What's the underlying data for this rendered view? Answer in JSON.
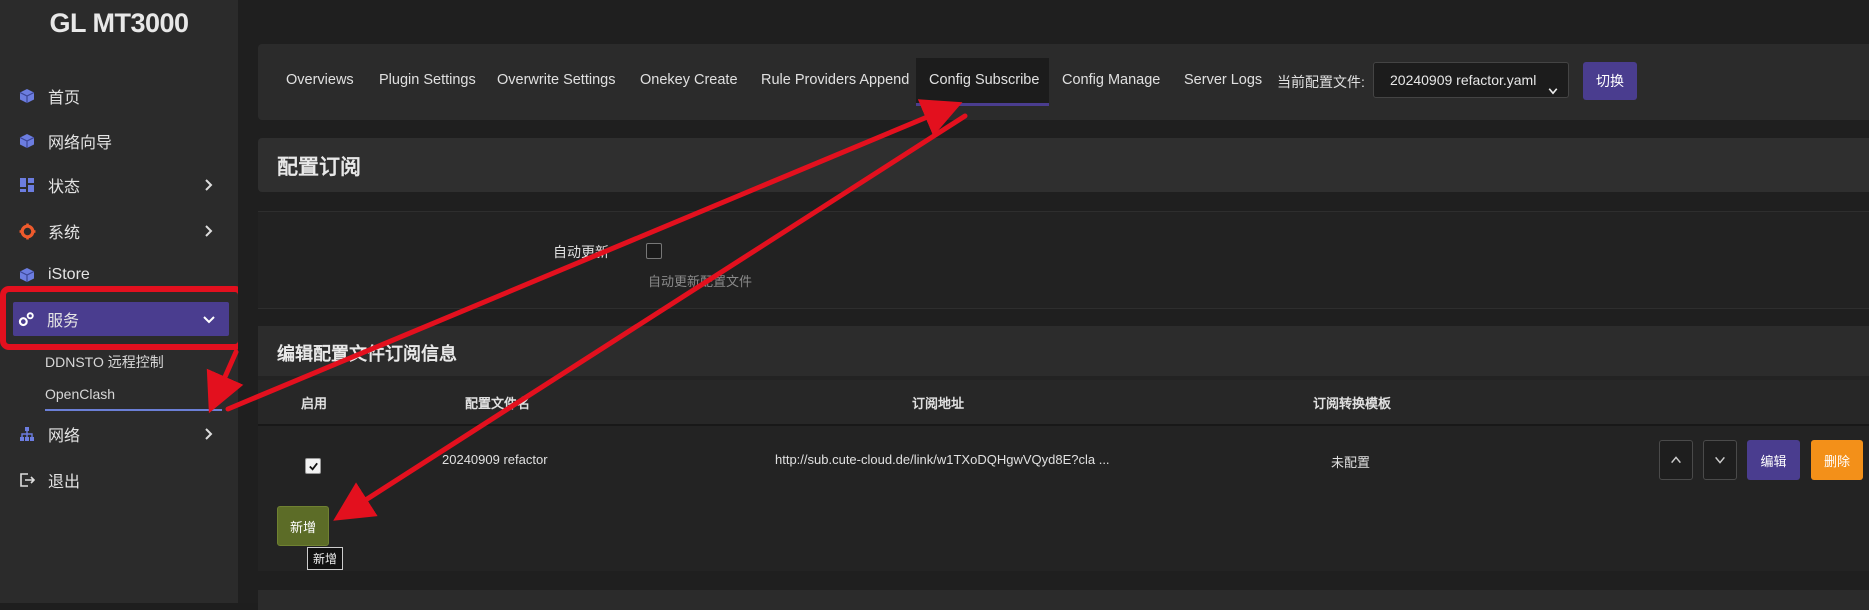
{
  "brand": "GL MT3000",
  "sidebar": {
    "items": [
      {
        "label": "首页",
        "icon": "cube-icon"
      },
      {
        "label": "网络向导",
        "icon": "cube-icon"
      },
      {
        "label": "状态",
        "icon": "dashboard-icon"
      },
      {
        "label": "系统",
        "icon": "gear-icon"
      },
      {
        "label": "iStore",
        "icon": "cube-icon"
      },
      {
        "label": "服务",
        "icon": "gears-icon"
      },
      {
        "label": "网络",
        "icon": "network-icon"
      },
      {
        "label": "退出",
        "icon": "logout-icon"
      }
    ],
    "sub_items": [
      "DDNSTO 远程控制",
      "OpenClash"
    ]
  },
  "tabs": [
    "Overviews",
    "Plugin Settings",
    "Overwrite Settings",
    "Onekey Create",
    "Rule Providers Append",
    "Config Subscribe",
    "Config Manage",
    "Server Logs"
  ],
  "active_tab": "Config Subscribe",
  "current_config": {
    "label": "当前配置文件:",
    "value": "20240909 refactor.yaml",
    "switch_label": "切换"
  },
  "section_title": "配置订阅",
  "auto_update": {
    "label": "自动更新",
    "checked": false,
    "description": "自动更新配置文件"
  },
  "edit": {
    "title": "编辑配置文件订阅信息",
    "columns": [
      "启用",
      "配置文件名",
      "订阅地址",
      "订阅转换模板"
    ],
    "rows": [
      {
        "enabled": true,
        "name": "20240909 refactor",
        "url": "http://sub.cute-cloud.de/link/w1TXoDQHgwVQyd8E?cla ...",
        "template": "未配置"
      }
    ],
    "edit_label": "编辑",
    "delete_label": "删除",
    "add_label": "新增",
    "tooltip": "新增"
  },
  "colors": {
    "accent": "#4a3d8f",
    "add_green": "#5c6c27",
    "delete_orange": "#f39019",
    "annotation_red": "#e3101e"
  }
}
